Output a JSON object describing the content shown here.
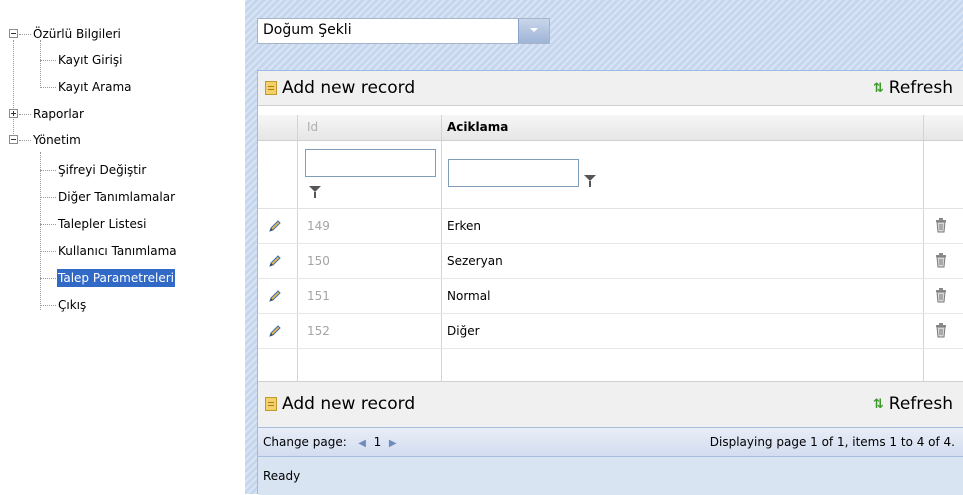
{
  "tree": {
    "items": [
      {
        "label": "Özürlü Bilgileri",
        "expander": "minus"
      },
      {
        "label": "Kayıt Girişi"
      },
      {
        "label": "Kayıt Arama"
      },
      {
        "label": "Raporlar",
        "expander": "plus"
      },
      {
        "label": "Yönetim",
        "expander": "minus"
      },
      {
        "label": "Şifreyi Değiştir"
      },
      {
        "label": "Diğer Tanımlamalar"
      },
      {
        "label": "Talepler Listesi"
      },
      {
        "label": "Kullanıcı Tanımlama"
      },
      {
        "label": "Talep Parametreleri",
        "selected": true
      },
      {
        "label": "Çıkış"
      }
    ]
  },
  "combo": {
    "value": "Doğum Şekli"
  },
  "toolbar": {
    "add_label": "Add new record",
    "refresh_label": "Refresh"
  },
  "grid": {
    "columns": [
      "Id",
      "Aciklama"
    ],
    "rows": [
      {
        "id": "149",
        "aciklama": "Erken"
      },
      {
        "id": "150",
        "aciklama": "Sezeryan"
      },
      {
        "id": "151",
        "aciklama": "Normal"
      },
      {
        "id": "152",
        "aciklama": "Diğer"
      }
    ]
  },
  "pager": {
    "label": "Change page:",
    "current_page": "1",
    "summary": "Displaying page 1 of 1, items 1 to 4 of 4."
  },
  "status": {
    "text": "Ready"
  },
  "colors": {
    "selection": "#3169c6",
    "panel_bg": "#c5d6ee",
    "grid_border": "#99bbe8"
  },
  "icons": [
    "pencil-icon",
    "trash-icon",
    "note-icon",
    "refresh-icon",
    "filter-icon",
    "chevron-down-icon"
  ]
}
